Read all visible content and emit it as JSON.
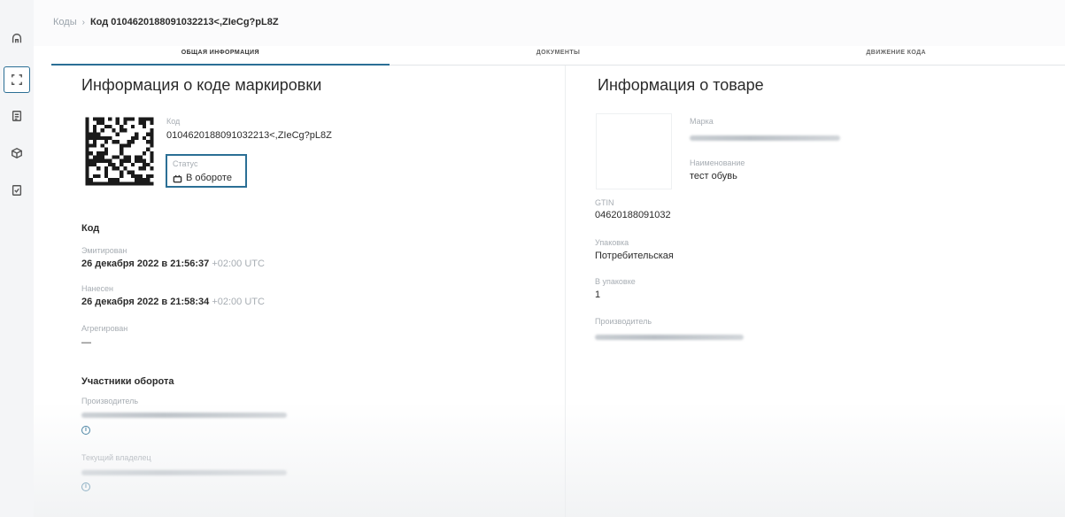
{
  "breadcrumb": {
    "root": "Коды",
    "current": "Код 0104620188091032213<,ZIeCg?pL8Z"
  },
  "tabs": [
    {
      "label": "ОБЩАЯ ИНФОРМАЦИЯ"
    },
    {
      "label": "ДОКУМЕНТЫ"
    },
    {
      "label": "ДВИЖЕНИЕ КОДА"
    }
  ],
  "left": {
    "title": "Информация о коде маркировки",
    "code_label": "Код",
    "code_value": "0104620188091032213<,ZIeCg?pL8Z",
    "status_label": "Статус",
    "status_value": "В обороте",
    "code_section": "Код",
    "emitted_label": "Эмитирован",
    "emitted_value": "26 декабря 2022 в 21:56:37",
    "emitted_tz": "+02:00 UTC",
    "applied_label": "Нанесен",
    "applied_value": "26 декабря 2022 в 21:58:34",
    "applied_tz": "+02:00 UTC",
    "aggregated_label": "Агрегирован",
    "aggregated_value": "—",
    "participants_title": "Участники оборота",
    "producer_label": "Производитель",
    "owner_label": "Текущий владелец"
  },
  "right": {
    "title": "Информация о товаре",
    "brand_label": "Марка",
    "name_label": "Наименование",
    "name_value": "тест обувь",
    "gtin_label": "GTIN",
    "gtin_value": "04620188091032",
    "package_label": "Упаковка",
    "package_value": "Потребительская",
    "in_package_label": "В упаковке",
    "in_package_value": "1",
    "producer_label": "Производитель"
  },
  "icons": [
    "home-icon",
    "scan-icon",
    "document-icon",
    "box-icon",
    "check-icon",
    "info-icon",
    "status-icon"
  ],
  "colors": {
    "accent": "#2b6f95"
  }
}
